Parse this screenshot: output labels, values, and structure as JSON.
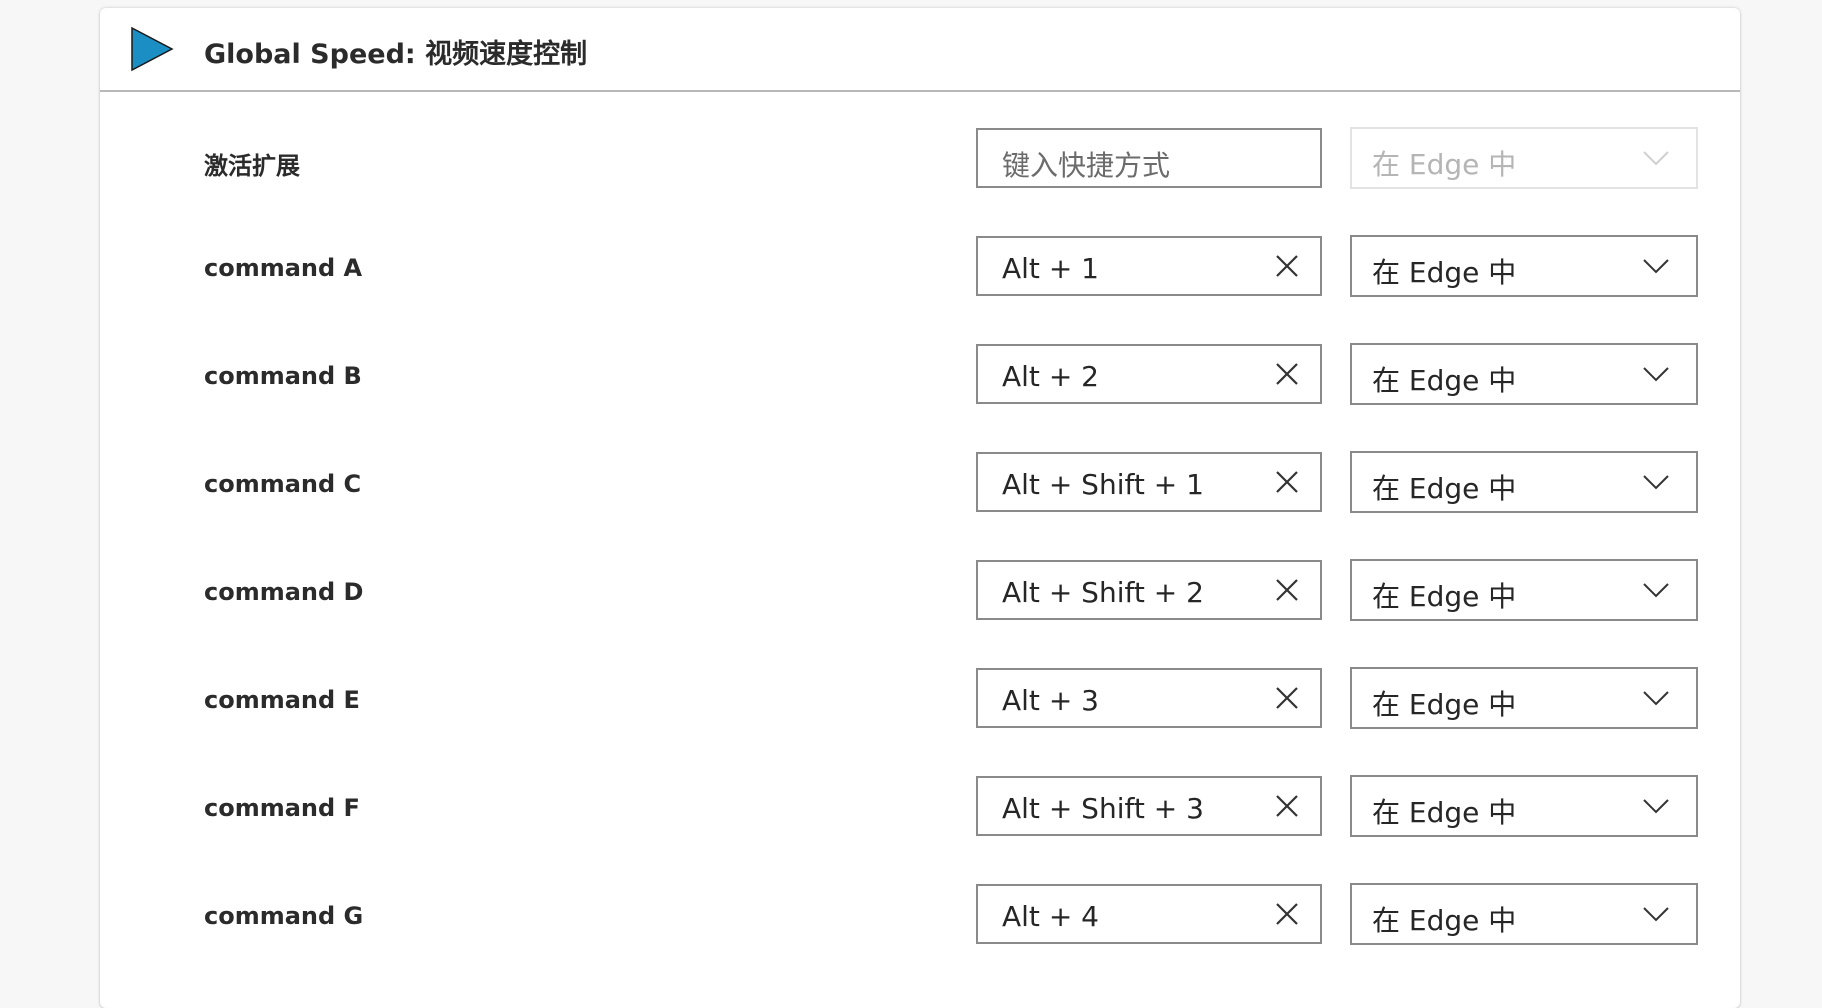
{
  "extension": {
    "title": "Global Speed: 视频速度控制",
    "icon": "play-triangle-icon",
    "icon_color": "#1b8fc4"
  },
  "activate_row": {
    "label": "激活扩展",
    "shortcut_placeholder": "键入快捷方式",
    "scope": "在 Edge 中",
    "scope_disabled": true
  },
  "commands": [
    {
      "label": "command A",
      "shortcut": "Alt + 1",
      "scope": "在 Edge 中"
    },
    {
      "label": "command B",
      "shortcut": "Alt + 2",
      "scope": "在 Edge 中"
    },
    {
      "label": "command C",
      "shortcut": "Alt + Shift + 1",
      "scope": "在 Edge 中"
    },
    {
      "label": "command D",
      "shortcut": "Alt + Shift + 2",
      "scope": "在 Edge 中"
    },
    {
      "label": "command E",
      "shortcut": "Alt + 3",
      "scope": "在 Edge 中"
    },
    {
      "label": "command F",
      "shortcut": "Alt + Shift + 3",
      "scope": "在 Edge 中"
    },
    {
      "label": "command G",
      "shortcut": "Alt + 4",
      "scope": "在 Edge 中"
    }
  ],
  "icons": {
    "clear": "close-icon",
    "dropdown": "chevron-down-icon"
  }
}
